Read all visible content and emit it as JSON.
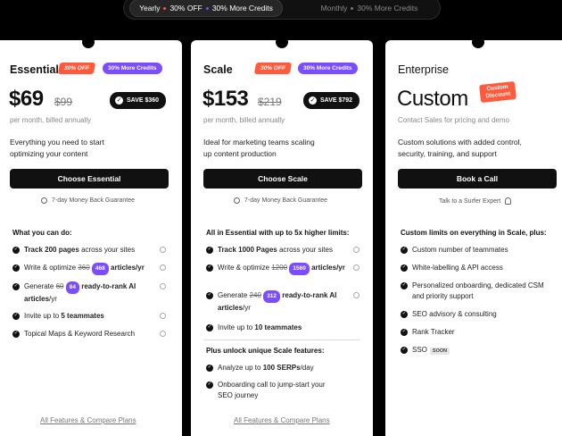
{
  "toggle": {
    "yearly_label": "Yearly",
    "yearly_off": "30% OFF",
    "yearly_credits": "30% More Credits",
    "monthly_label": "Monthly",
    "monthly_credits": "30% More Credits"
  },
  "essential": {
    "title": "Essential",
    "badge_off": "30% OFF",
    "badge_credits": "30% More Credits",
    "price": "$69",
    "price_old": "$99",
    "save": "SAVE $360",
    "billing": "per month, billed annually",
    "desc": "Everything you need to start optimizing your content",
    "cta": "Choose Essential",
    "guarantee": "7-day Money Back Guarantee",
    "section": "What you can do:",
    "f1_bold": "Track 200 pages",
    "f1_rest": "across your sites",
    "f2_pre": "Write & optimize",
    "f2_old": "360",
    "f2_new": "468",
    "f2_post": "articles/yr",
    "f3_pre": "Generate",
    "f3_old": "60",
    "f3_new": "84",
    "f3_bold": "ready-to-rank AI articles",
    "f3_post": "/yr",
    "f4_pre": "Invite up to",
    "f4_bold": "5 teammates",
    "f5": "Topical Maps & Keyword Research",
    "footer": "All Features & Compare Plans"
  },
  "scale": {
    "title": "Scale",
    "badge_off": "30% OFF",
    "badge_credits": "30% More Credits",
    "price": "$153",
    "price_old": "$219",
    "save": "SAVE $792",
    "billing": "per month, billed annually",
    "desc": "Ideal for marketing teams scaling up content production",
    "cta": "Choose Scale",
    "guarantee": "7-day Money Back Guarantee",
    "section": "All in Essential with up to 5x higher limits:",
    "f1_bold": "Track 1000 Pages",
    "f1_rest": "across your sites",
    "f2_pre": "Write & optimize",
    "f2_old": "1200",
    "f2_new": "1560",
    "f2_post": "articles/yr",
    "f3_pre": "Generate",
    "f3_old": "240",
    "f3_new": "312",
    "f3_bold": "ready-to-rank AI articles",
    "f3_post": "/yr",
    "f4_pre": "Invite up to",
    "f4_bold": "10 teammates",
    "section2": "Plus unlock unique Scale features:",
    "u1_pre": "Analyze up to",
    "u1_bold": "100 SERPs",
    "u1_post": "/day",
    "u2": "Onboarding call to jump-start your SEO journey",
    "footer": "All Features & Compare Plans"
  },
  "enterprise": {
    "title": "Enterprise",
    "price": "Custom",
    "tag": "Custom Discount",
    "billing": "Contact Sales for pricing and demo",
    "desc": "Custom solutions with added control, security, training, and support",
    "cta": "Book a Call",
    "talk": "Talk to a Surfer Expert",
    "section": "Custom limits on everything in Scale, plus:",
    "f1": "Custom number of teammates",
    "f2": "White-labelling & API access",
    "f3": "Personalized onboarding, dedicated CSM and priority support",
    "f4": "SEO advisory & consulting",
    "f5": "Rank Tracker",
    "f6": "SSO",
    "soon": "SOON"
  }
}
